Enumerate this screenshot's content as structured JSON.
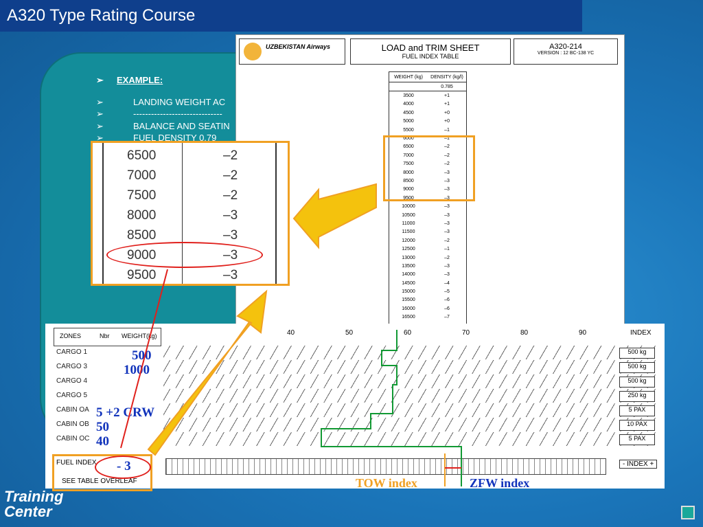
{
  "window": {
    "title": "A320 Type Rating Course"
  },
  "bullets": {
    "example": "EXAMPLE:",
    "lines": [
      "LANDING WEIGHT   AC",
      "------------------------------",
      "BALANCE AND SEATIN",
      "FUEL DENSITY 0.79"
    ]
  },
  "sheet": {
    "airline": "UZBEKISTAN Airways",
    "title": "LOAD and TRIM SHEET",
    "subtitle": "FUEL INDEX TABLE",
    "model": "A320-214",
    "version": "VERSION : 12 BC-138 YC",
    "table": {
      "headers": [
        "WEIGHT (kg)",
        "DENSITY (kg/l)"
      ],
      "density": "0.785",
      "rows": [
        [
          "3500",
          "+1"
        ],
        [
          "4000",
          "+1"
        ],
        [
          "4500",
          "+0"
        ],
        [
          "5000",
          "+0"
        ],
        [
          "5500",
          "–1"
        ],
        [
          "6000",
          "–1"
        ],
        [
          "6500",
          "–2"
        ],
        [
          "7000",
          "–2"
        ],
        [
          "7500",
          "–2"
        ],
        [
          "8000",
          "–3"
        ],
        [
          "8500",
          "–3"
        ],
        [
          "9000",
          "–3"
        ],
        [
          "9500",
          "–3"
        ],
        [
          "10000",
          "–3"
        ],
        [
          "10500",
          "–3"
        ],
        [
          "11000",
          "–3"
        ],
        [
          "11500",
          "–3"
        ],
        [
          "12000",
          "–2"
        ],
        [
          "12500",
          "–1"
        ],
        [
          "13000",
          "–2"
        ],
        [
          "13500",
          "–3"
        ],
        [
          "14000",
          "–3"
        ],
        [
          "14500",
          "–4"
        ],
        [
          "15000",
          "–5"
        ],
        [
          "15500",
          "–6"
        ],
        [
          "16000",
          "–6"
        ],
        [
          "16500",
          "–7"
        ]
      ]
    }
  },
  "zoom": {
    "rows": [
      [
        "6500",
        "–2"
      ],
      [
        "7000",
        "–2"
      ],
      [
        "7500",
        "–2"
      ],
      [
        "8000",
        "–3"
      ],
      [
        "8500",
        "–3"
      ],
      [
        "9000",
        "–3"
      ],
      [
        "9500",
        "–3"
      ]
    ]
  },
  "load": {
    "headers": [
      "ZONES",
      "Nbr",
      "WEIGHT(kg)"
    ],
    "axis": [
      "40",
      "50",
      "60",
      "70",
      "80",
      "90",
      "INDEX"
    ],
    "zones": [
      "CARGO 1",
      "CARGO 3",
      "CARGO 4",
      "CARGO 5",
      "CABIN OA",
      "CABIN OB",
      "CABIN OC"
    ],
    "units": [
      "500 kg",
      "500 kg",
      "500 kg",
      "250 kg",
      "5 PAX",
      "10 PAX",
      "5 PAX"
    ],
    "notes": {
      "cargo1": "500",
      "cargo3": "1000",
      "cabin_oa": "5 +2 CRW",
      "cabin_ob": "50",
      "cabin_oc": "40"
    },
    "fuel_index": "FUEL INDEX",
    "fuel_value": "- 3",
    "see_table": "SEE TABLE OVERLEAF",
    "index_label": "- INDEX +"
  },
  "labels": {
    "tow": "TOW index",
    "zfw": "ZFW index"
  },
  "footer": {
    "logo": "Training Center"
  },
  "colors": {
    "orange": "#f0a023",
    "red": "#e0201c",
    "blue": "#1133bb",
    "green": "#119933"
  }
}
